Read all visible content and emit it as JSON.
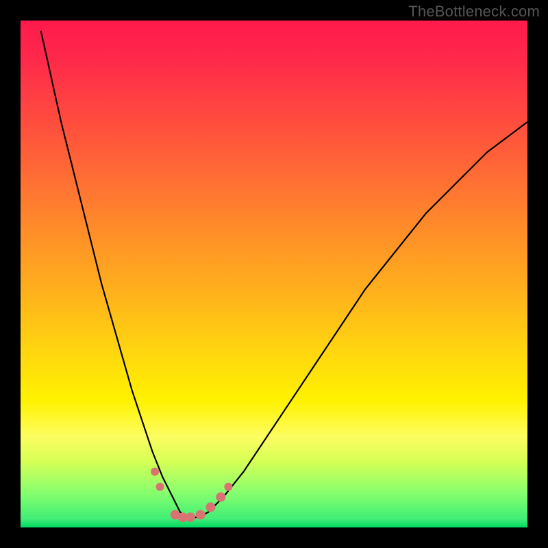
{
  "watermark": "TheBottleneck.com",
  "chart_data": {
    "type": "line",
    "title": "",
    "xlabel": "",
    "ylabel": "",
    "xlim": [
      0,
      100
    ],
    "ylim": [
      0,
      100
    ],
    "grid": false,
    "legend": false,
    "series": [
      {
        "name": "bottleneck-curve",
        "x": [
          4,
          6,
          8,
          10,
          12,
          14,
          16,
          18,
          20,
          22,
          24,
          26,
          28,
          30,
          31.5,
          33,
          35,
          37,
          40,
          44,
          48,
          52,
          56,
          60,
          64,
          68,
          72,
          76,
          80,
          84,
          88,
          92,
          96,
          100
        ],
        "y": [
          98,
          89,
          80,
          72,
          64,
          56,
          48,
          41,
          34,
          27,
          21,
          15,
          10,
          6,
          3,
          2,
          2,
          3,
          6,
          11,
          17,
          23,
          29,
          35,
          41,
          47,
          52,
          57,
          62,
          66,
          70,
          74,
          77,
          80
        ]
      }
    ],
    "points": [
      {
        "x": 26.5,
        "y": 11,
        "r": 6
      },
      {
        "x": 27.5,
        "y": 8,
        "r": 6
      },
      {
        "x": 30.5,
        "y": 2.5,
        "r": 7
      },
      {
        "x": 32.0,
        "y": 2,
        "r": 7
      },
      {
        "x": 33.5,
        "y": 2,
        "r": 7
      },
      {
        "x": 35.5,
        "y": 2.5,
        "r": 7
      },
      {
        "x": 37.5,
        "y": 4,
        "r": 7
      },
      {
        "x": 39.5,
        "y": 6,
        "r": 7
      },
      {
        "x": 41.0,
        "y": 8,
        "r": 6
      }
    ],
    "gradient_map": "red-to-green-vertical",
    "annotations": []
  }
}
